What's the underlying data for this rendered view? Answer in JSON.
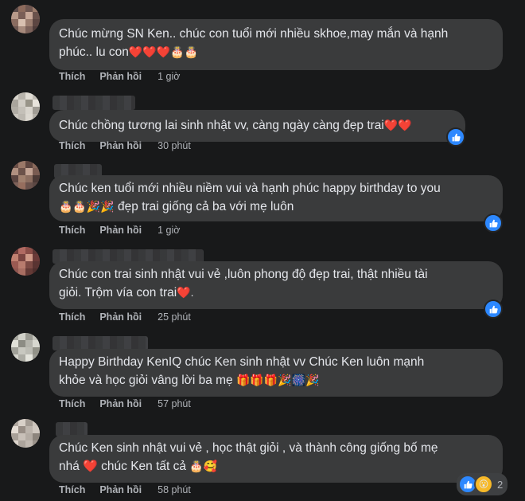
{
  "actions": {
    "like_label": "Thích",
    "reply_label": "Phản hồi"
  },
  "comments": [
    {
      "text_line1": "Chúc mừng SN Ken.. chúc con tuổi mới nhiều skhoe,may mắn và hạnh",
      "text_line2": "phúc.. lu con",
      "emoji_tail": "❤️❤️❤️🎂🎂",
      "time": "1 giờ"
    },
    {
      "text_line1": "Chúc chồng tương lai sinh nhật vv, càng ngày càng đẹp trai",
      "emoji_tail": "❤️❤️",
      "time": "30 phút"
    },
    {
      "text_line1": "Chúc ken tuổi mới nhiều niềm vui và hạnh phúc happy birthday to you",
      "emoji_lead": "🎂🎂🎉🎉",
      "text_line2": " đẹp trai giống cả ba với mẹ luôn",
      "time": "1 giờ"
    },
    {
      "text_line1": "Chúc con trai sinh nhật vui vẻ ,luôn phong độ đẹp trai, thật nhiều tài",
      "text_line2": "giỏi. Trộm vía con trai",
      "emoji_tail": "❤️.",
      "time": "25 phút"
    },
    {
      "text_line1": "Happy Birthday KenIQ chúc Ken sinh nhật vv Chúc Ken luôn mạnh",
      "text_line2": "khỏe và học giỏi vâng lời ba mẹ ",
      "emoji_tail": "🎁🎁🎁🎉🎆🎉",
      "time": "57 phút"
    },
    {
      "text_line1": "Chúc Ken sinh nhật vui vẻ , học thật giỏi , và thành công giống bố mẹ",
      "text_line2a": "nhá ",
      "heart": "❤️",
      "text_line2b": " chúc Ken tất cả ",
      "emoji_tail": "🎂🥰",
      "time": "58 phút"
    }
  ],
  "reactions": {
    "last_count": "2",
    "last_wow": "😮"
  },
  "colors": {
    "background": "#18191a",
    "bubble": "#3a3b3c",
    "accent": "#2d88ff",
    "heart": "#f02849"
  }
}
